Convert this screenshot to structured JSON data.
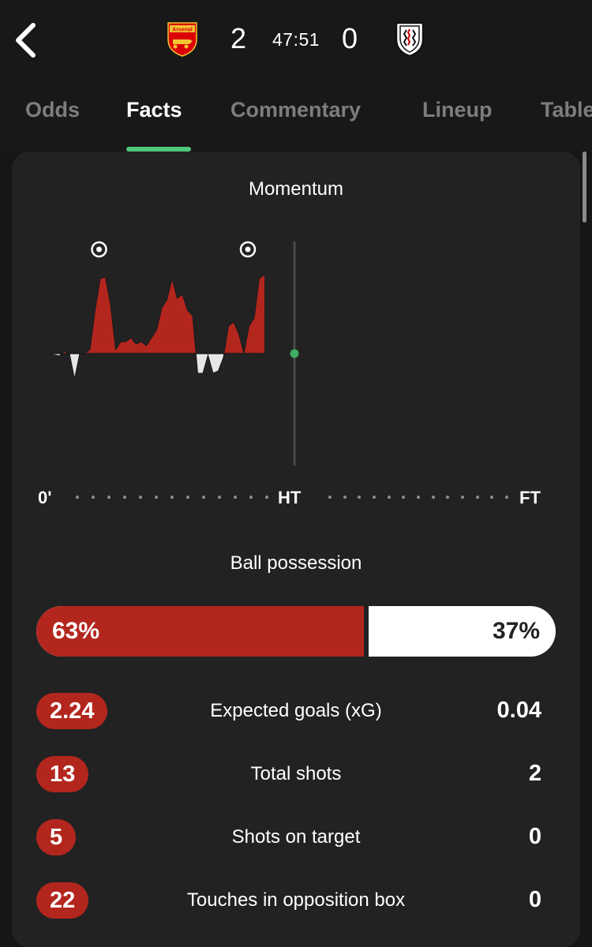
{
  "match": {
    "home_team_crest": "arsenal-crest",
    "home_crest_text": "Arsenal",
    "away_team_crest": "fulham-crest",
    "home_score": "2",
    "away_score": "0",
    "clock": "47:51"
  },
  "tabs": [
    {
      "label": "Odds",
      "active": false
    },
    {
      "label": "Facts",
      "active": true
    },
    {
      "label": "Commentary",
      "active": false
    },
    {
      "label": "Lineup",
      "active": false
    },
    {
      "label": "Table",
      "active": false
    }
  ],
  "momentum": {
    "title": "Momentum",
    "timeline": {
      "start": "0'",
      "half": "HT",
      "end": "FT"
    },
    "current_minute": 47.85,
    "goal_minutes": [
      9,
      38
    ],
    "colors": {
      "home": "#b3261e",
      "away": "#e6e6e6",
      "live_dot": "#3fae62"
    },
    "chart_data": {
      "type": "area",
      "x": [
        0,
        2,
        3,
        4,
        5,
        6,
        7,
        8,
        9,
        10,
        11,
        12,
        13,
        14,
        15,
        16,
        17,
        18,
        19,
        20,
        21,
        22,
        23,
        24,
        25,
        26,
        27,
        28,
        29,
        30,
        31,
        32,
        33,
        34,
        35,
        36,
        37,
        38,
        39,
        40,
        41,
        42,
        43,
        44,
        45,
        46,
        47,
        48
      ],
      "y": [
        0,
        -3,
        3,
        0,
        -32,
        0,
        0,
        5,
        55,
        95,
        97,
        62,
        5,
        15,
        15,
        20,
        12,
        15,
        10,
        20,
        30,
        58,
        68,
        95,
        70,
        75,
        55,
        48,
        -25,
        -25,
        -2,
        -25,
        -22,
        -5,
        35,
        40,
        25,
        0,
        35,
        45,
        95,
        100
      ],
      "ylim": [
        -100,
        100
      ]
    }
  },
  "possession": {
    "title": "Ball possession",
    "home_pct": 63,
    "home_label": "63%",
    "away_label": "37%"
  },
  "stats": [
    {
      "home": "2.24",
      "label": "Expected goals (xG)",
      "away": "0.04"
    },
    {
      "home": "13",
      "label": "Total shots",
      "away": "2"
    },
    {
      "home": "5",
      "label": "Shots on target",
      "away": "0"
    },
    {
      "home": "22",
      "label": "Touches in opposition box",
      "away": "0"
    }
  ]
}
